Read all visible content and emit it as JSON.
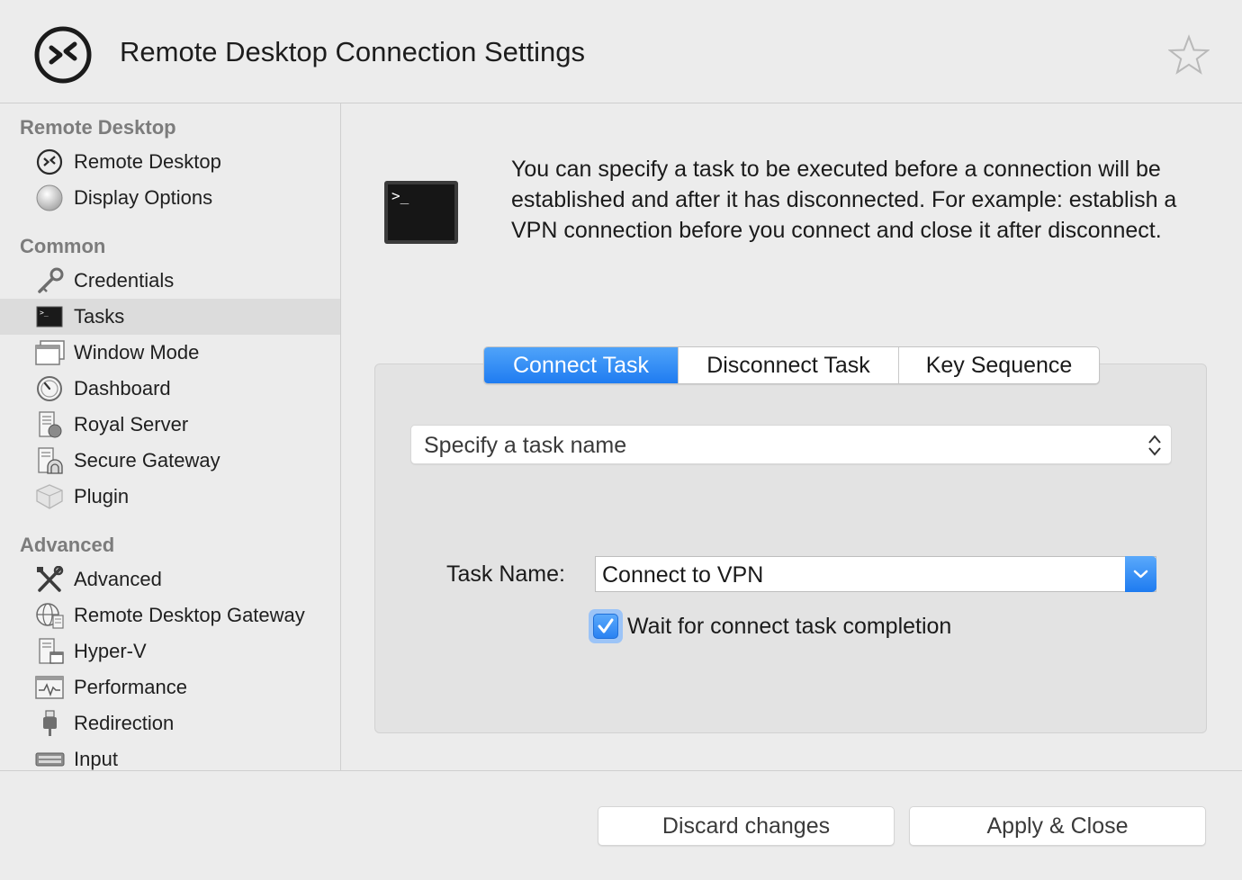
{
  "window": {
    "title": "Remote Desktop Connection Settings",
    "logo_icon": "remote-desktop-logo-icon",
    "favorite_icon": "star-icon"
  },
  "sidebar": {
    "sections": [
      {
        "title": "Remote Desktop",
        "items": [
          {
            "label": "Remote Desktop",
            "icon": "remote-desktop-icon"
          },
          {
            "label": "Display Options",
            "icon": "display-options-icon"
          }
        ]
      },
      {
        "title": "Common",
        "items": [
          {
            "label": "Credentials",
            "icon": "key-icon"
          },
          {
            "label": "Tasks",
            "icon": "terminal-icon",
            "selected": true
          },
          {
            "label": "Window Mode",
            "icon": "window-icon"
          },
          {
            "label": "Dashboard",
            "icon": "gauge-icon"
          },
          {
            "label": "Royal Server",
            "icon": "server-icon"
          },
          {
            "label": "Secure Gateway",
            "icon": "secure-gateway-icon"
          },
          {
            "label": "Plugin",
            "icon": "plugin-icon"
          }
        ]
      },
      {
        "title": "Advanced",
        "items": [
          {
            "label": "Advanced",
            "icon": "tools-icon"
          },
          {
            "label": "Remote Desktop Gateway",
            "icon": "globe-server-icon"
          },
          {
            "label": "Hyper-V",
            "icon": "hyper-v-icon"
          },
          {
            "label": "Performance",
            "icon": "performance-icon"
          },
          {
            "label": "Redirection",
            "icon": "usb-icon"
          },
          {
            "label": "Input",
            "icon": "keyboard-icon"
          }
        ]
      }
    ]
  },
  "content": {
    "description": "You can specify a task to be executed before a connection will be established and after it has disconnected. For example: establish a VPN connection before you connect and close it after disconnect.",
    "tabs": [
      {
        "label": "Connect Task",
        "active": true
      },
      {
        "label": "Disconnect Task",
        "active": false
      },
      {
        "label": "Key Sequence",
        "active": false
      }
    ],
    "task_select": {
      "value": "Specify a task name"
    },
    "task_name": {
      "label": "Task Name:",
      "value": "Connect to VPN"
    },
    "wait_checkbox": {
      "label": "Wait for connect task completion",
      "checked": true
    }
  },
  "footer": {
    "discard_label": "Discard changes",
    "apply_label": "Apply & Close"
  },
  "colors": {
    "accent": "#1f7cf1",
    "selected_row": "#dcdcdc",
    "background": "#ececec"
  }
}
